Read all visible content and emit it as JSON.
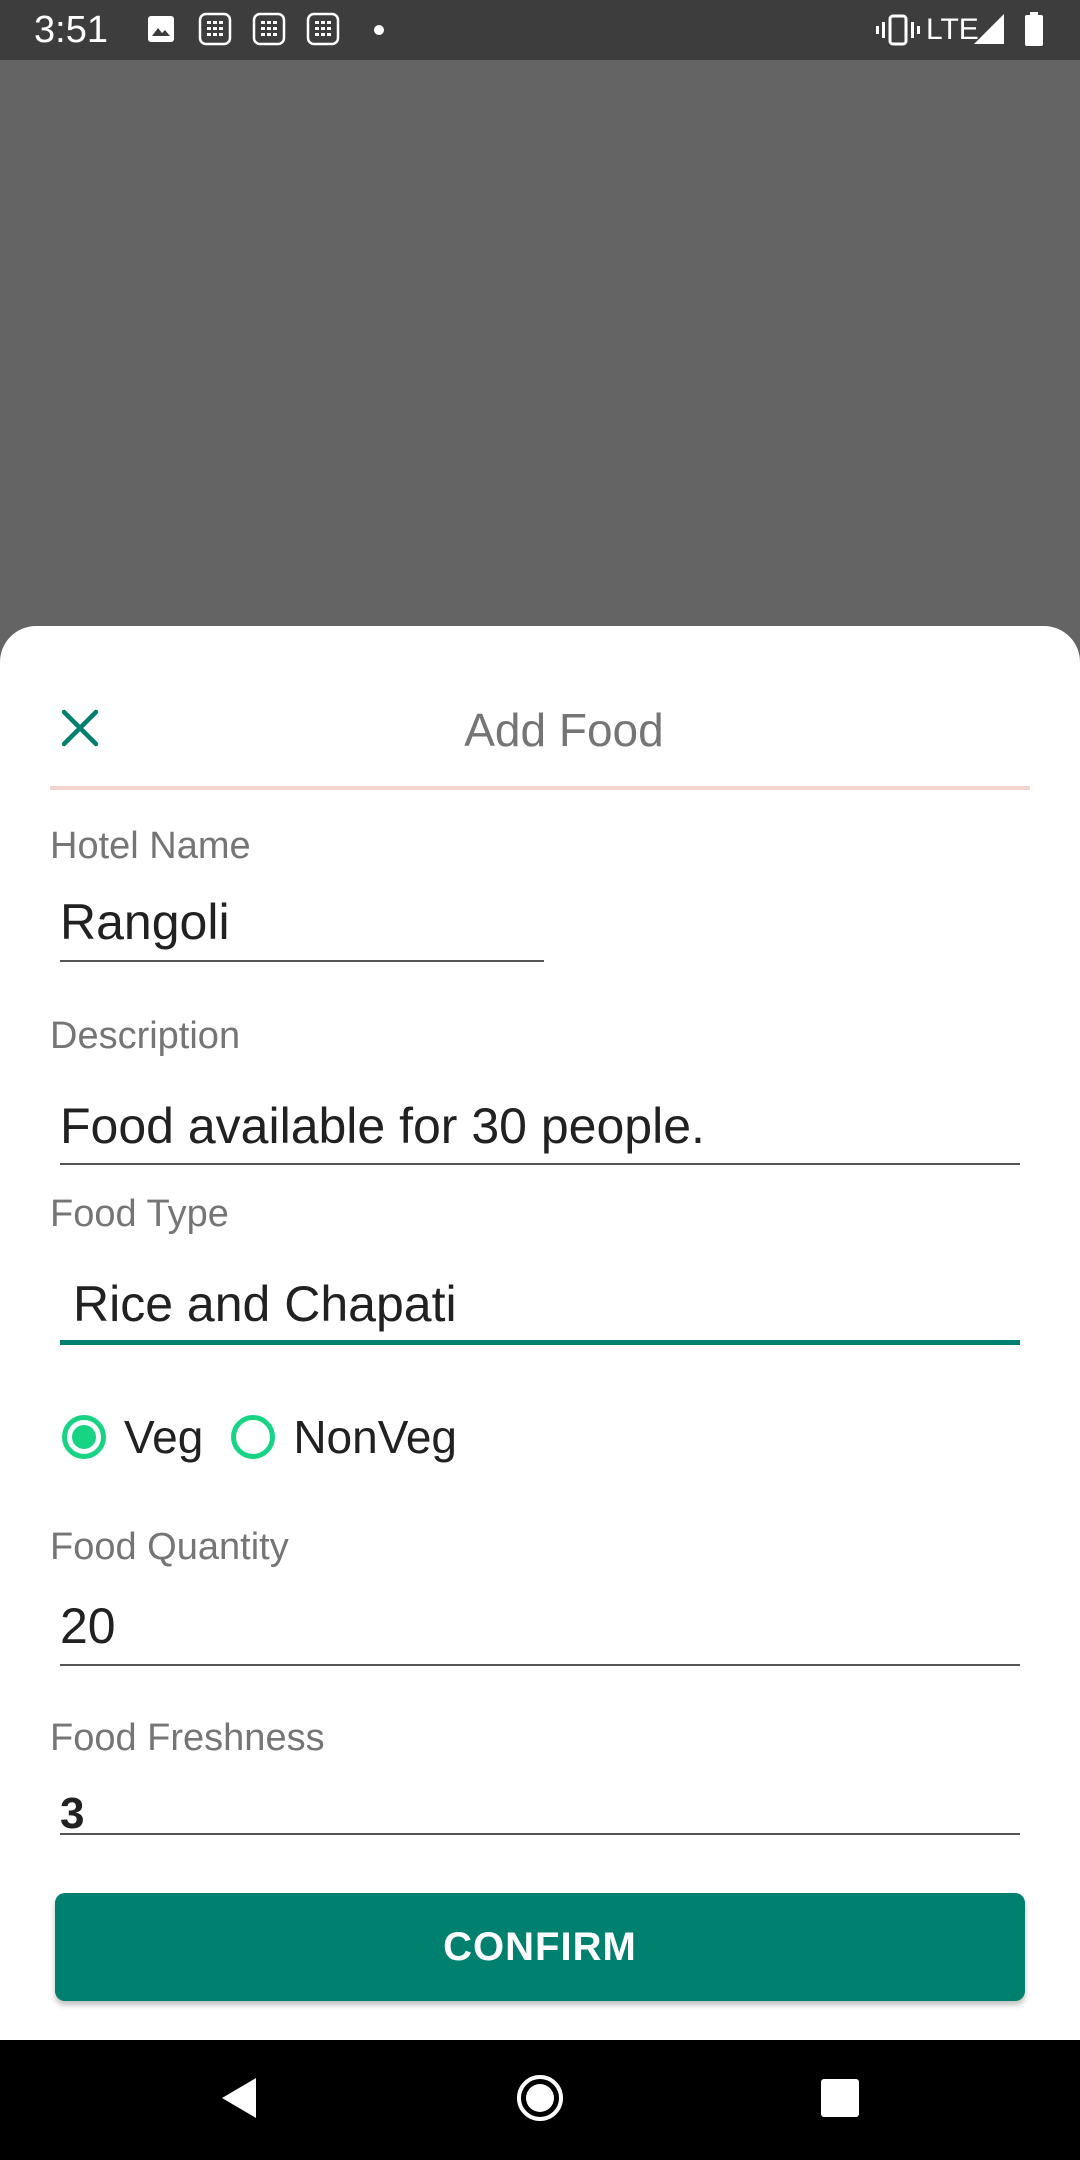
{
  "status_bar": {
    "time": "3:51",
    "network": "LTE",
    "icons": [
      "image-icon",
      "calculator-icon",
      "calculator-icon",
      "calculator-icon",
      "dot-icon",
      "vibrate-icon",
      "signal-icon",
      "battery-icon"
    ]
  },
  "sheet": {
    "title": "Add Food",
    "close_icon": "close-icon",
    "accent_color": "#00806f"
  },
  "form": {
    "hotel_name": {
      "label": "Hotel Name",
      "value": "Rangoli"
    },
    "description": {
      "label": "Description",
      "value": "Food available for 30 people."
    },
    "food_type": {
      "label": "Food Type",
      "value": "Rice and Chapati"
    },
    "category": {
      "options": [
        "Veg",
        "NonVeg"
      ],
      "selected": "Veg"
    },
    "food_quantity": {
      "label": "Food Quantity",
      "value": "20"
    },
    "food_freshness": {
      "label": "Food Freshness",
      "value": "3"
    }
  },
  "confirm_label": "CONFIRM",
  "nav_bar": {
    "icons": [
      "back-icon",
      "home-icon",
      "recents-icon"
    ]
  }
}
